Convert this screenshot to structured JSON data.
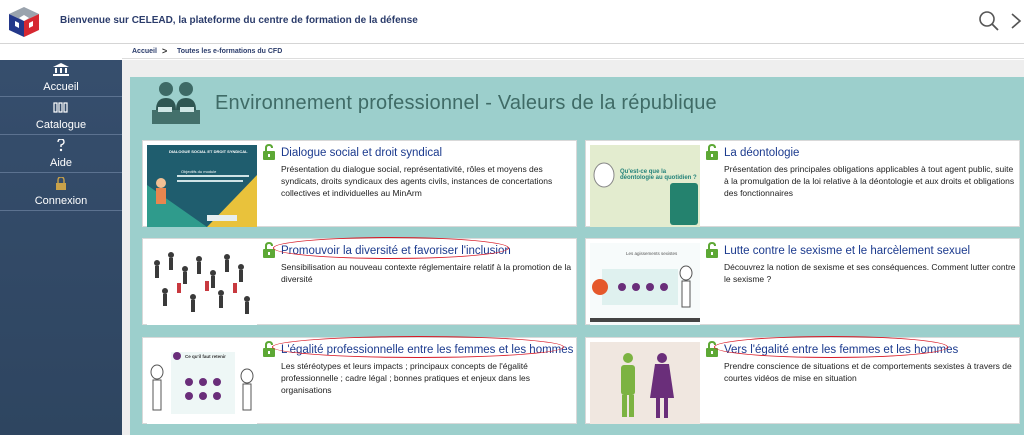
{
  "header": {
    "welcome": "Bienvenue sur CELEAD, la plateforme du centre de formation de la défense",
    "icons": [
      "logo-cube",
      "search-icon",
      "chevron-right-icon"
    ]
  },
  "breadcrumb": {
    "items": [
      "Accueil",
      "Toutes les e-formations du CFD"
    ],
    "separator": ">"
  },
  "sidebar": {
    "items": [
      {
        "label": "Accueil",
        "icon": "institution-icon"
      },
      {
        "label": "Catalogue",
        "icon": "books-icon"
      },
      {
        "label": "Aide",
        "icon": "question-icon"
      },
      {
        "label": "Connexion",
        "icon": "lock-icon"
      }
    ]
  },
  "section": {
    "title": "Environnement professionnel - Valeurs de la république"
  },
  "courses": [
    {
      "title": "Dialogue social et droit syndical",
      "description": "Présentation du dialogue social, représentativité, rôles et moyens des syndicats, droits syndicaux des agents civils, instances de concertations collectives et individuelles au MinArm",
      "thumb": {
        "heading": "DIALOGUE SOCIAL ET DROIT SYNDICAL",
        "sub": "Objectifs du module"
      }
    },
    {
      "title": "La déontologie",
      "description": "Présentation des principales obligations applicables à tout agent public, suite à la promulgation de la loi relative à la déontologie et aux droits et obligations des fonctionnaires",
      "thumb": {
        "heading": "Qu'est-ce que la déontologie au quotidien ?"
      }
    },
    {
      "title": "Promouvoir la diversité et favoriser l'inclusion",
      "description": "Sensibilisation au nouveau contexte réglementaire relatif à la promotion de la diversité",
      "thumb": {}
    },
    {
      "title": "Lutte contre le sexisme et le harcèlement sexuel",
      "description": "Découvrez la notion de sexisme et ses conséquences. Comment lutter contre le sexisme ?",
      "thumb": {
        "heading": "Les agissements sexistes"
      }
    },
    {
      "title": "L'égalité professionnelle entre les femmes et les hommes",
      "description": "Les stéréotypes et leurs impacts ; principaux concepts de l'égalité professionnelle ; cadre légal ; bonnes pratiques et enjeux dans les organisations",
      "thumb": {
        "heading": "Ce qu'il faut retenir"
      }
    },
    {
      "title": "Vers l'égalité entre les femmes et les hommes",
      "description": "Prendre conscience de situations et de comportements sexistes à travers de courtes vidéos de mise en situation",
      "thumb": {}
    }
  ],
  "colors": {
    "accent": "#1b3a8e",
    "panel": "#9ccfcc",
    "sidebar": "#364e6d",
    "lock": "#5da835",
    "annotation": "#d71a26"
  }
}
